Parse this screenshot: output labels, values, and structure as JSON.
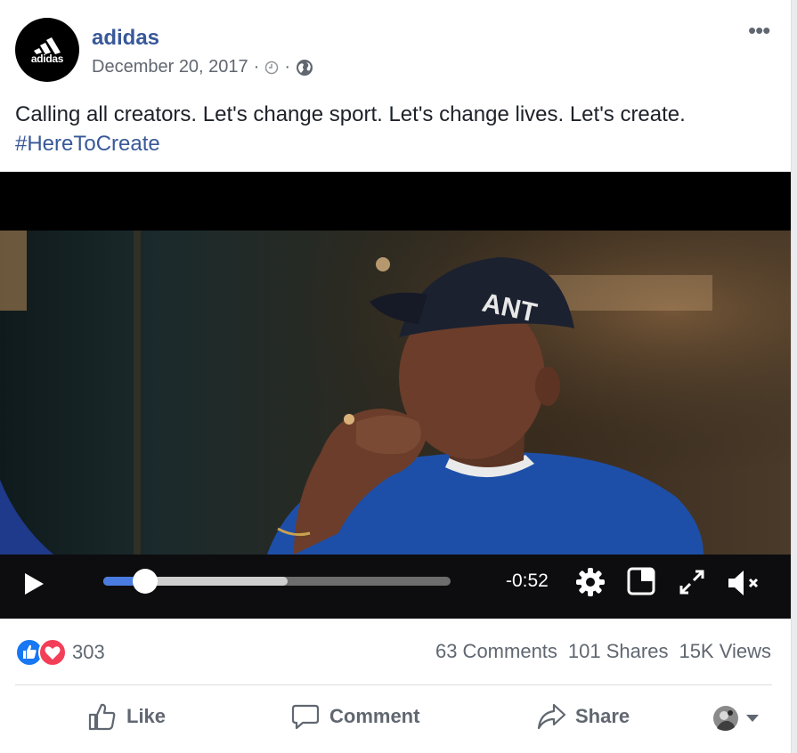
{
  "post": {
    "page_name": "adidas",
    "avatar_logo_text": "adidas",
    "date": "December 20, 2017",
    "separator": "·",
    "caption": "Calling all creators. Let's change sport. Let's change lives. Let's create.",
    "hashtag": "#HereToCreate",
    "more_label": "•••"
  },
  "video": {
    "time_remaining": "-0:52",
    "progress_played": 0.12,
    "progress_buffered": 0.53,
    "cap_text": "ANT"
  },
  "stats": {
    "reaction_count": "303",
    "comments": "63 Comments",
    "shares": "101 Shares",
    "views": "15K Views"
  },
  "actions": {
    "like": "Like",
    "comment": "Comment",
    "share": "Share"
  },
  "colors": {
    "link": "#385898",
    "like_blue": "#1877f2",
    "love_red": "#f33e58",
    "progress_blue": "#4a7be0"
  }
}
